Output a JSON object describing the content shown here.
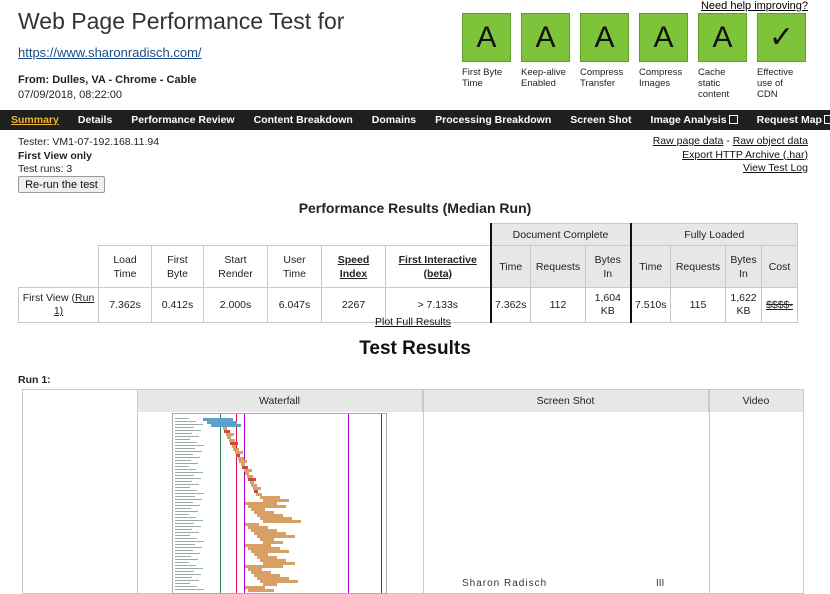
{
  "header": {
    "help_link": "Need help improving?",
    "title": "Web Page Performance Test for",
    "url": "https://www.sharonradisch.com/",
    "from": "From: Dulles, VA - Chrome - Cable",
    "date": "07/09/2018, 08:22:00"
  },
  "grades": [
    {
      "grade": "A",
      "label_1": "First Byte",
      "label_2": "Time",
      "label_3": ""
    },
    {
      "grade": "A",
      "label_1": "Keep-alive",
      "label_2": "Enabled",
      "label_3": ""
    },
    {
      "grade": "A",
      "label_1": "Compress",
      "label_2": "Transfer",
      "label_3": ""
    },
    {
      "grade": "A",
      "label_1": "Compress",
      "label_2": "Images",
      "label_3": ""
    },
    {
      "grade": "A",
      "label_1": "Cache",
      "label_2": "static",
      "label_3": "content"
    },
    {
      "grade": "✓",
      "label_1": "Effective",
      "label_2": "use of CDN",
      "label_3": ""
    }
  ],
  "nav": {
    "summary": "Summary",
    "details": "Details",
    "performance_review": "Performance Review",
    "content_breakdown": "Content Breakdown",
    "domains": "Domains",
    "processing_breakdown": "Processing Breakdown",
    "screen_shot": "Screen Shot",
    "image_analysis": "Image Analysis",
    "request_map": "Request Map"
  },
  "test_info": {
    "tester": "Tester: VM1-07-192.168.11.94",
    "first_view_only": "First View only",
    "test_runs": "Test runs: 3",
    "rerun_button": "Re-run the test"
  },
  "right_links": {
    "raw_page_data": "Raw page data",
    "separator": " - ",
    "raw_object_data": "Raw object data",
    "export_har": "Export HTTP Archive (.har)",
    "view_test_log": "View Test Log"
  },
  "perf_results": {
    "heading": "Performance Results (Median Run)",
    "group_document_complete": "Document Complete",
    "group_fully_loaded": "Fully Loaded",
    "headers": {
      "load_time_1": "Load",
      "load_time_2": "Time",
      "first_byte_1": "First",
      "first_byte_2": "Byte",
      "start_render_1": "Start",
      "start_render_2": "Render",
      "user_time_1": "User",
      "user_time_2": "Time",
      "speed_index_1": "Speed",
      "speed_index_2": "Index",
      "first_interactive_1": "First Interactive",
      "first_interactive_2": "(beta)",
      "dc_time": "Time",
      "dc_requests": "Requests",
      "dc_bytes_1": "Bytes",
      "dc_bytes_2": "In",
      "fl_time": "Time",
      "fl_requests": "Requests",
      "fl_bytes_1": "Bytes",
      "fl_bytes_2": "In",
      "cost": "Cost"
    },
    "row": {
      "label_1": "First View (",
      "run_link": "Run",
      "label_2": "1)",
      "load_time": "7.362s",
      "first_byte": "0.412s",
      "start_render": "2.000s",
      "user_time": "6.047s",
      "speed_index": "2267",
      "first_interactive": "> 7.133s",
      "dc_time": "7.362s",
      "dc_requests": "112",
      "dc_bytes_1": "1,604",
      "dc_bytes_2": "KB",
      "fl_time": "7.510s",
      "fl_requests": "115",
      "fl_bytes_1": "1,622",
      "fl_bytes_2": "KB",
      "cost": "$$$$-"
    }
  },
  "plot_link": "Plot Full Results",
  "test_results_heading": "Test Results",
  "run_label": "Run 1:",
  "run_table": {
    "col_waterfall": "Waterfall",
    "col_screenshot": "Screen Shot",
    "col_video": "Video",
    "screenshot_text": "Sharon Radisch",
    "screenshot_mark": "III"
  },
  "colors": {
    "grade_green": "#7ec43b",
    "nav_bg": "#1f1f1f",
    "nav_active": "#f1b82d"
  }
}
